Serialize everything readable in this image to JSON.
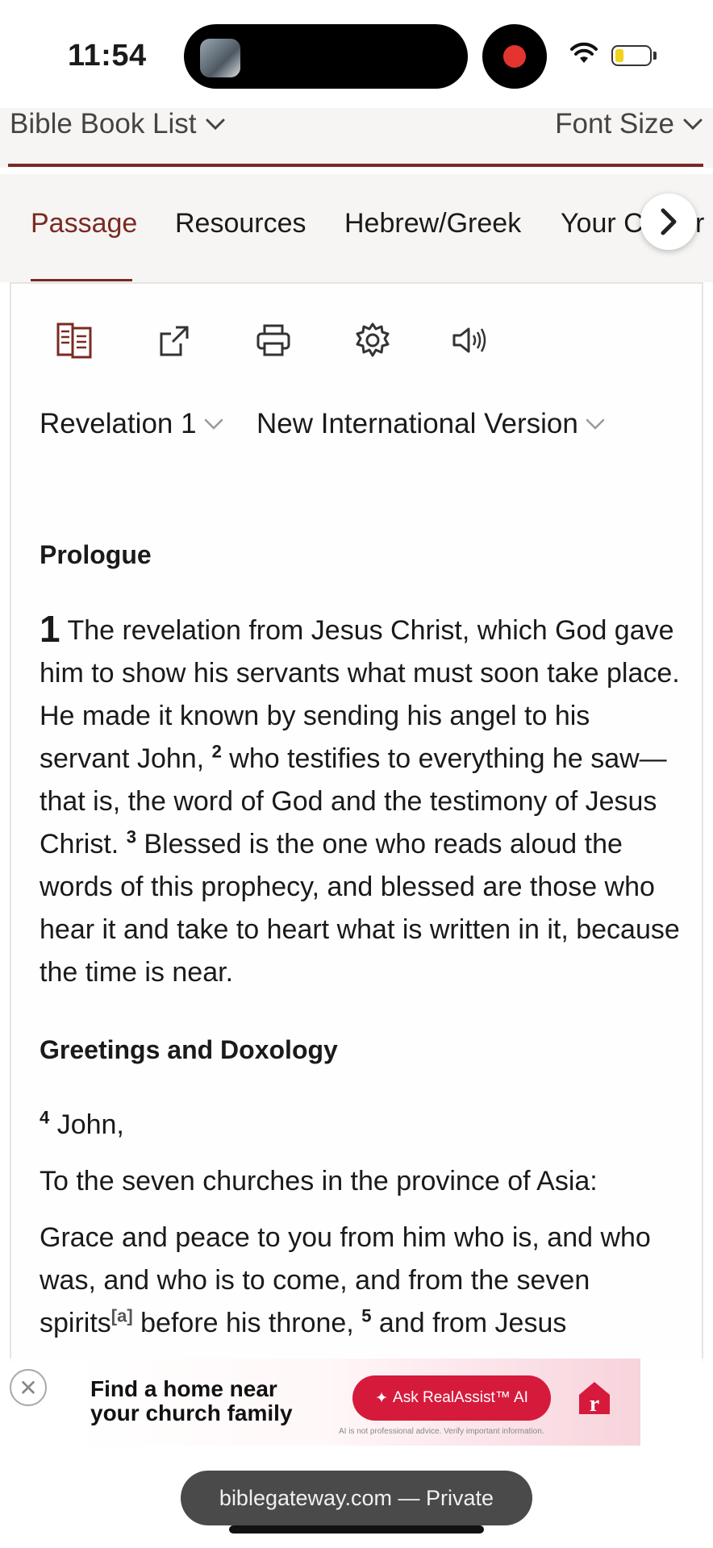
{
  "status_bar": {
    "time": "11:54"
  },
  "topbar": {
    "book_list": "Bible Book List",
    "font_size": "Font Size"
  },
  "tabs": [
    {
      "label": "Passage"
    },
    {
      "label": "Resources"
    },
    {
      "label": "Hebrew/Greek"
    },
    {
      "label": "Your C"
    },
    {
      "label": "r"
    }
  ],
  "toolbar": {
    "icons": [
      "parallel-icon",
      "share-icon",
      "print-icon",
      "settings-icon",
      "audio-icon"
    ]
  },
  "selectors": {
    "passage": "Revelation 1",
    "version": "New International Version"
  },
  "passage": {
    "heading1": "Prologue",
    "chapter": "1",
    "v1": "The revelation from Jesus Christ, which God gave him to show his servants what must soon take place. He made it known by sending his angel to his servant John,",
    "v2_num": "2",
    "v2": "who testifies to everything he saw—that is, the word of God and the testimony of Jesus Christ.",
    "v3_num": "3",
    "v3": "Blessed is the one who reads aloud the words of this prophecy, and blessed are those who hear it and take to heart what is written in it, because the time is near.",
    "heading2": "Greetings and Doxology",
    "v4_num": "4",
    "v4": "John,",
    "p_churches": "To the seven churches in the province of Asia:",
    "p_grace_a": "Grace and peace to you from him who is, and who was, and who is to come, and from the seven spirits",
    "footnote": "[a]",
    "p_grace_b": "before his throne,",
    "v5_num": "5",
    "v5": "and from Jesus"
  },
  "ad": {
    "headline": "Find a home near your church family",
    "cta": "Ask RealAssist™ AI",
    "disclaimer": "AI is not professional advice. Verify important information.",
    "close": "✕"
  },
  "browser": {
    "url": "biblegateway.com — Private"
  },
  "colors": {
    "accent": "#7a2a22",
    "ad_cta": "#d61a3c"
  }
}
